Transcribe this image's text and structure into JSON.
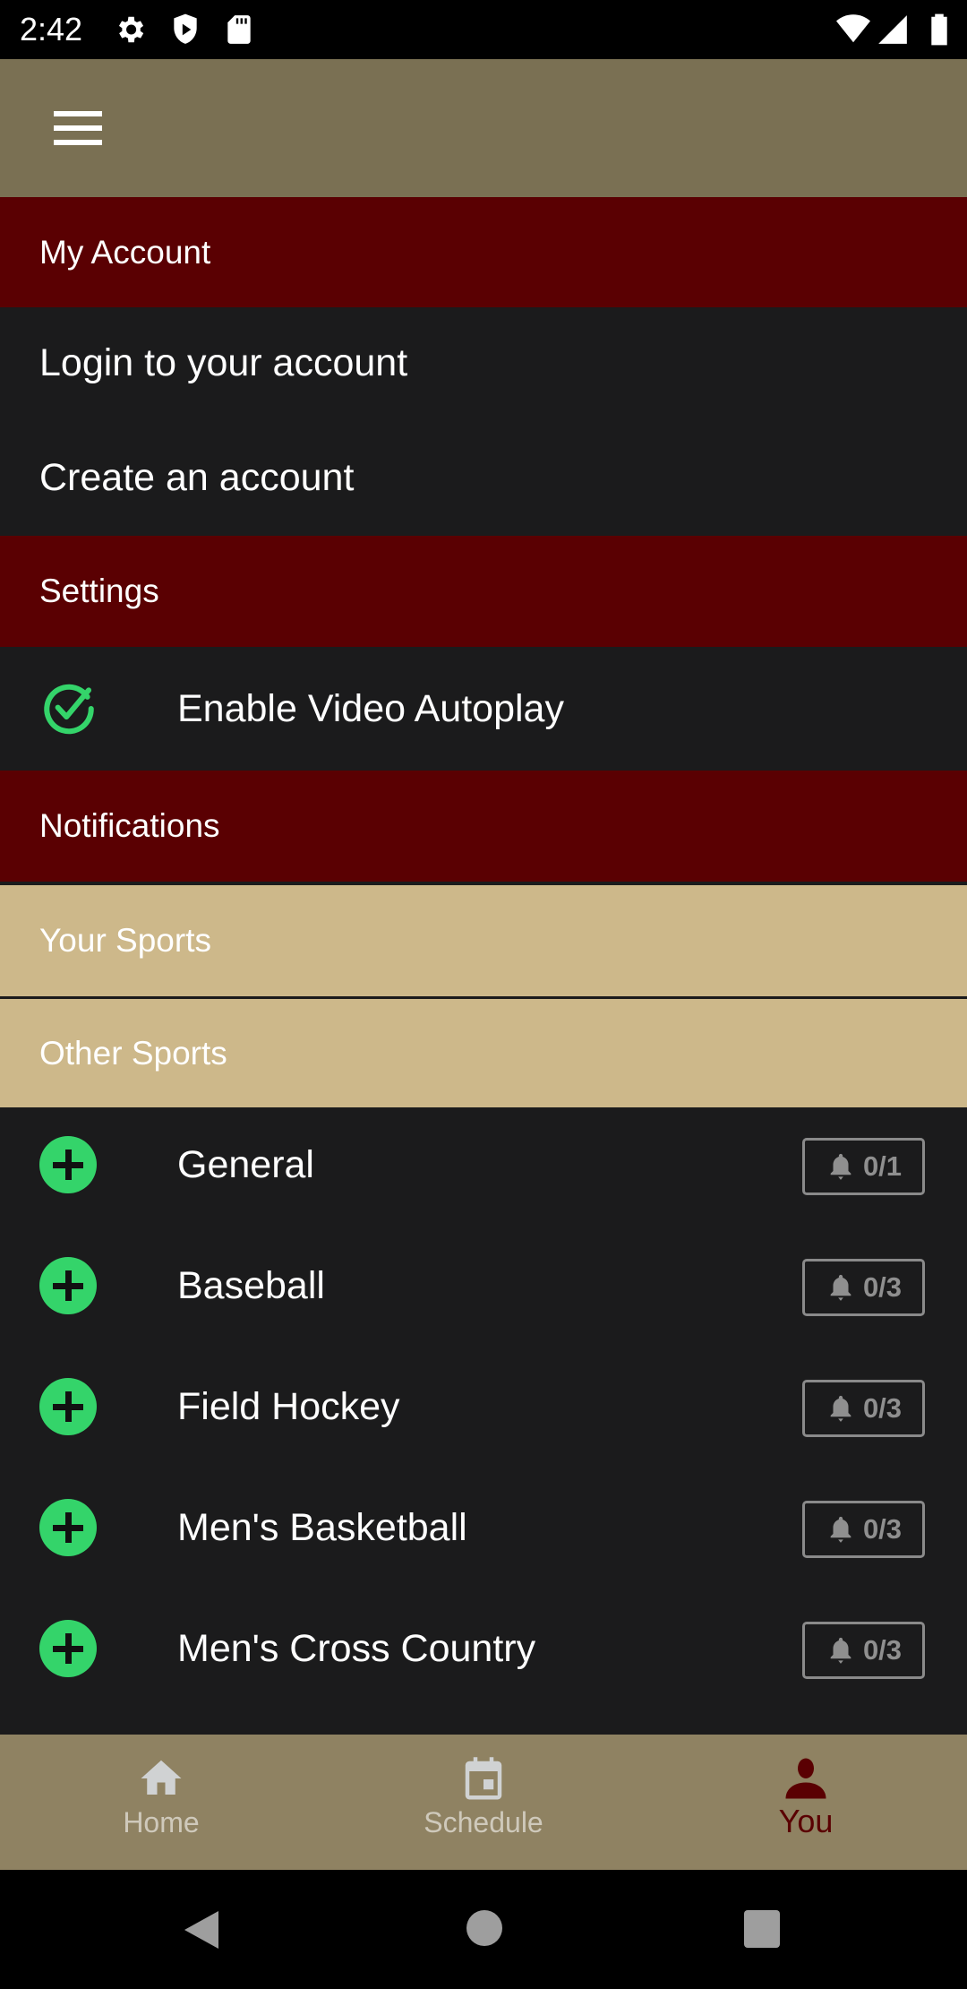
{
  "status_bar": {
    "time": "2:42",
    "left_icons": [
      "gear-icon",
      "shield-play-icon",
      "sd-card-icon"
    ],
    "right_icons": [
      "wifi-icon",
      "signal-icon",
      "battery-icon"
    ]
  },
  "app_bar": {
    "menu_icon": "hamburger-menu-icon"
  },
  "account": {
    "header": "My Account",
    "login": "Login to your account",
    "create": "Create an account"
  },
  "settings": {
    "header": "Settings",
    "autoplay_label": "Enable Video Autoplay",
    "autoplay_enabled": true
  },
  "notifications": {
    "header": "Notifications",
    "your_sports": "Your Sports",
    "other_sports": "Other Sports",
    "sports": [
      {
        "name": "General",
        "count": "0/1"
      },
      {
        "name": "Baseball",
        "count": "0/3"
      },
      {
        "name": "Field Hockey",
        "count": "0/3"
      },
      {
        "name": "Men's Basketball",
        "count": "0/3"
      },
      {
        "name": "Men's Cross Country",
        "count": "0/3"
      }
    ]
  },
  "bottom_nav": {
    "items": [
      {
        "label": "Home",
        "icon": "home-icon",
        "active": false
      },
      {
        "label": "Schedule",
        "icon": "calendar-icon",
        "active": false
      },
      {
        "label": "You",
        "icon": "person-icon",
        "active": true
      }
    ]
  },
  "colors": {
    "app_bar": "#7a7053",
    "section_header": "#5a0002",
    "tan_header": "#cdb88a",
    "accent_green": "#34d46a",
    "bottom_nav": "#8f8262",
    "active_nav": "#5a0002"
  }
}
